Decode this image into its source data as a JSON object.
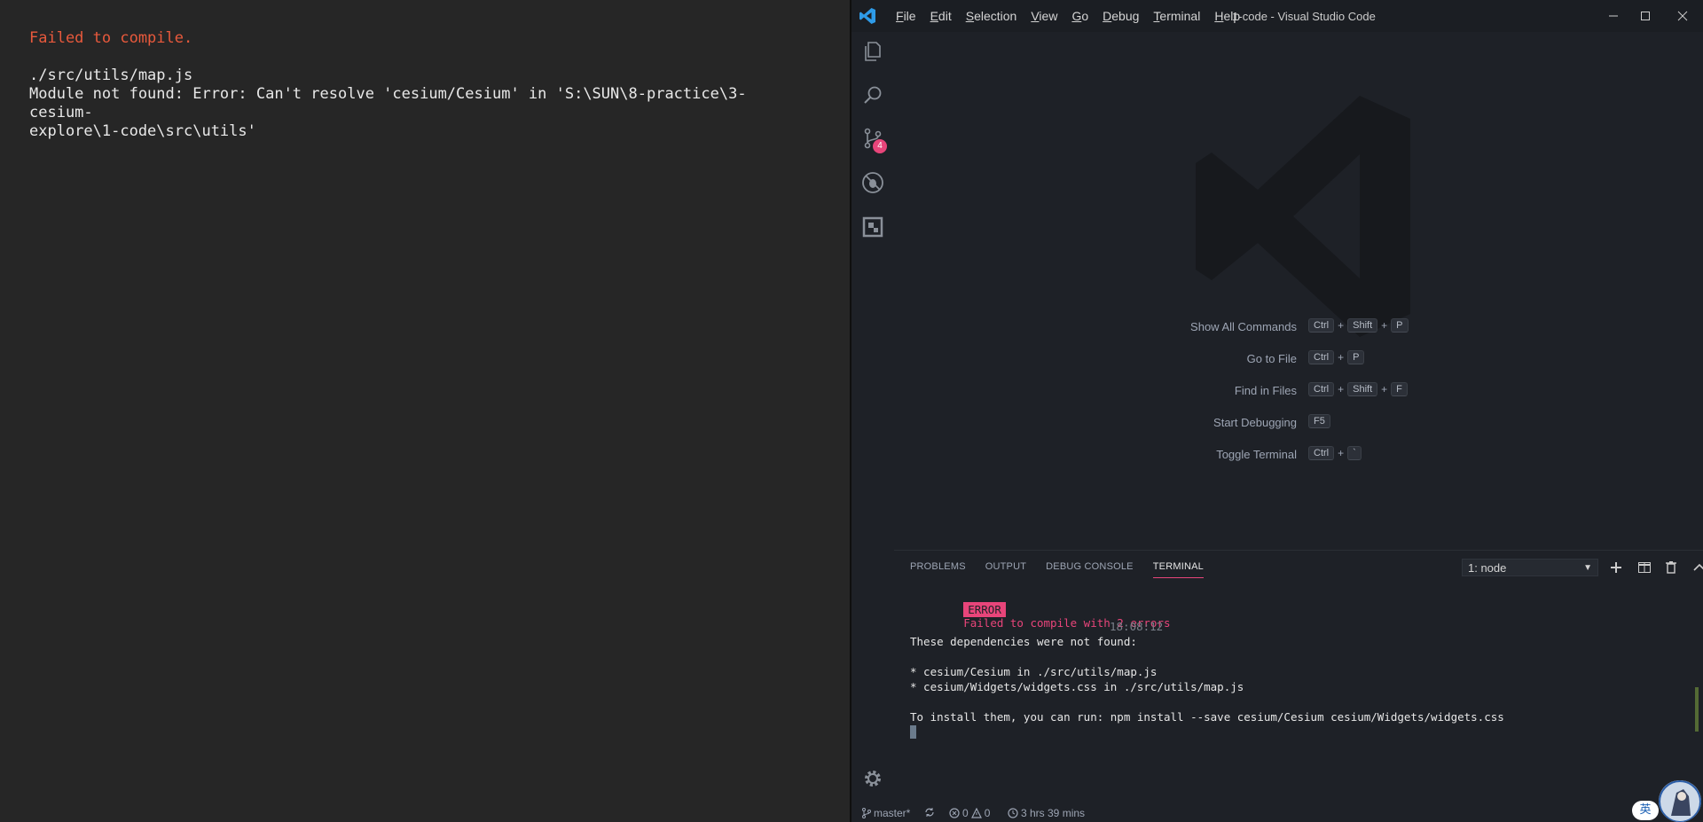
{
  "browser_overlay": {
    "title": "Failed to compile.",
    "file": "./src/utils/map.js",
    "message": "Module not found: Error: Can't resolve 'cesium/Cesium' in 'S:\\SUN\\8-practice\\3-cesium-\nexplore\\1-code\\src\\utils'"
  },
  "vscode": {
    "window_title": "1-code - Visual Studio Code",
    "menu": [
      {
        "label": "File",
        "mnemonic": "F",
        "rest": "ile"
      },
      {
        "label": "Edit",
        "mnemonic": "E",
        "rest": "dit"
      },
      {
        "label": "Selection",
        "mnemonic": "S",
        "rest": "election"
      },
      {
        "label": "View",
        "mnemonic": "V",
        "rest": "iew"
      },
      {
        "label": "Go",
        "mnemonic": "G",
        "rest": "o"
      },
      {
        "label": "Debug",
        "mnemonic": "D",
        "rest": "ebug"
      },
      {
        "label": "Terminal",
        "mnemonic": "T",
        "rest": "erminal"
      },
      {
        "label": "Help",
        "mnemonic": "H",
        "rest": "elp"
      }
    ],
    "activity_bar": {
      "icons": [
        "explorer-icon",
        "search-icon",
        "source-control-icon",
        "debug-icon",
        "extensions-icon",
        "settings-gear-icon"
      ],
      "scm_badge": "4"
    },
    "shortcuts": [
      {
        "label": "Show All Commands",
        "keys": [
          "Ctrl",
          "Shift",
          "P"
        ]
      },
      {
        "label": "Go to File",
        "keys": [
          "Ctrl",
          "P"
        ]
      },
      {
        "label": "Find in Files",
        "keys": [
          "Ctrl",
          "Shift",
          "F"
        ]
      },
      {
        "label": "Start Debugging",
        "keys": [
          "F5"
        ]
      },
      {
        "label": "Toggle Terminal",
        "keys": [
          "Ctrl",
          "`"
        ]
      }
    ],
    "panel": {
      "tabs": [
        "PROBLEMS",
        "OUTPUT",
        "DEBUG CONSOLE",
        "TERMINAL"
      ],
      "active_tab": "TERMINAL",
      "terminal_select": "1: node",
      "terminal": {
        "error_badge": "ERROR",
        "error_text": "Failed to compile with 2 errors",
        "timestamp": "18:08:12",
        "line1": "These dependencies were not found:",
        "dep1": "* cesium/Cesium in ./src/utils/map.js",
        "dep2": "* cesium/Widgets/widgets.css in ./src/utils/map.js",
        "install": "To install them, you can run: npm install --save cesium/Cesium cesium/Widgets/widgets.css"
      }
    },
    "statusbar": {
      "branch": "master*",
      "errors": "0",
      "warnings": "0",
      "time_tracked": "3 hrs 39 mins"
    }
  },
  "ime_indicator": "英",
  "colors": {
    "error_red": "#e8593c",
    "accent_pink": "#e8457a",
    "editor_bg": "#1e2127"
  }
}
